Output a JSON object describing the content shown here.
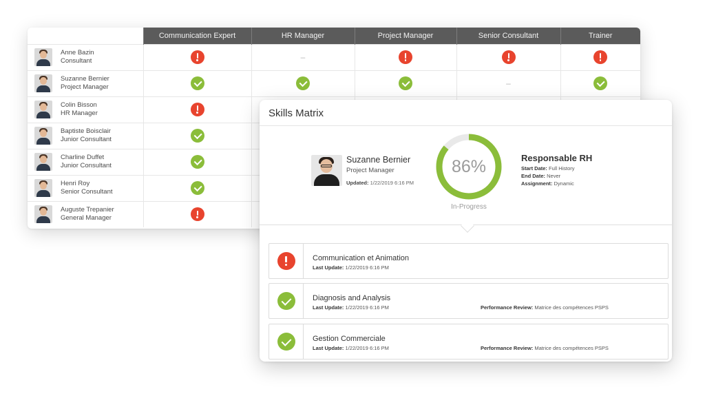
{
  "grid": {
    "columns": [
      "Communication Expert",
      "HR Manager",
      "Project Manager",
      "Senior Consultant",
      "Trainer"
    ],
    "rows": [
      {
        "name": "Anne Bazin",
        "title": "Consultant",
        "cells": [
          "error",
          "dash",
          "error",
          "error",
          "error"
        ]
      },
      {
        "name": "Suzanne Bernier",
        "title": "Project Manager",
        "cells": [
          "ok",
          "ok",
          "ok",
          "dash",
          "ok"
        ]
      },
      {
        "name": "Colin Bisson",
        "title": "HR Manager",
        "cells": [
          "error",
          "",
          "",
          "",
          ""
        ]
      },
      {
        "name": "Baptiste Boisclair",
        "title": "Junior Consultant",
        "cells": [
          "ok",
          "",
          "",
          "",
          ""
        ]
      },
      {
        "name": "Charline Duffet",
        "title": "Junior Consultant",
        "cells": [
          "ok",
          "",
          "",
          "",
          ""
        ]
      },
      {
        "name": "Henri Roy",
        "title": "Senior Consultant",
        "cells": [
          "ok",
          "",
          "",
          "",
          ""
        ]
      },
      {
        "name": "Auguste Trepanier",
        "title": "General Manager",
        "cells": [
          "error",
          "",
          "",
          "",
          ""
        ]
      }
    ],
    "dash_symbol": "–"
  },
  "matrix": {
    "title": "Skills Matrix",
    "profile": {
      "name": "Suzanne Bernier",
      "role": "Project Manager",
      "updated_label": "Updated:",
      "updated_value": "1/22/2019 6:16 PM"
    },
    "progress": {
      "percent": 86,
      "label": "86%",
      "status": "In-Progress"
    },
    "assignment": {
      "title": "Responsable RH",
      "start_label": "Start Date:",
      "start_value": "Full History",
      "end_label": "End Date:",
      "end_value": "Never",
      "type_label": "Assignment:",
      "type_value": "Dynamic"
    },
    "skills": [
      {
        "name": "Communication et Animation",
        "status": "error",
        "update_label": "Last Update:",
        "update_value": "1/22/2019 6:16 PM",
        "review_label": "",
        "review_value": ""
      },
      {
        "name": "Diagnosis and Analysis",
        "status": "ok",
        "update_label": "Last Update:",
        "update_value": "1/22/2019 6:16 PM",
        "review_label": "Performance Review:",
        "review_value": "Matrice des compétences PSPS"
      },
      {
        "name": "Gestion Commerciale",
        "status": "ok",
        "update_label": "Last Update:",
        "update_value": "1/22/2019 6:16 PM",
        "review_label": "Performance Review:",
        "review_value": "Matrice des compétences PSPS"
      }
    ]
  },
  "colors": {
    "ok": "#8bbd3a",
    "error": "#e8442e",
    "ring_track": "#e9e9e9",
    "header_bg": "#5b5b5b"
  },
  "icons": {
    "ok": "check-circle-icon",
    "error": "alert-circle-icon",
    "dash": "dash-icon"
  }
}
